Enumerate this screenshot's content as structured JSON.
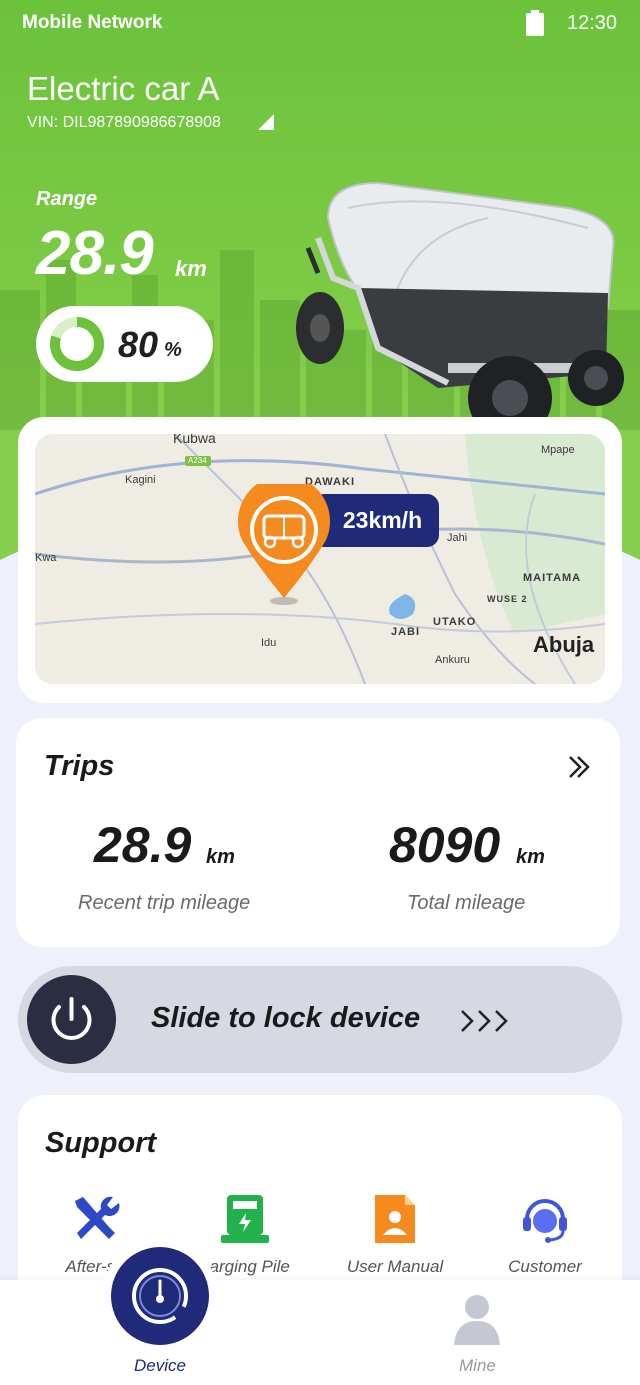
{
  "status_bar": {
    "network": "Mobile Network",
    "time": "12:30",
    "battery_icon": "battery-full-icon"
  },
  "vehicle": {
    "name": "Electric car A",
    "vin": "VIN: DIL987890986678908",
    "range_label": "Range",
    "range_value": "28.9",
    "range_unit": "km",
    "battery_percent": "80",
    "battery_percent_unit": "%",
    "battery_level": 0.8
  },
  "map": {
    "labels": [
      "Kubwa",
      "A234",
      "Kagini",
      "DAWAKI",
      "Mpape",
      "Jahi",
      "Kwa",
      "MAITAMA",
      "WUSE 2",
      "JABI",
      "UTAKO",
      "Idu",
      "Ankuru",
      "Abuja"
    ],
    "speed": "23km/h",
    "pin_icon": "tricycle-location-pin-icon"
  },
  "trips": {
    "title": "Trips",
    "more_icon": "double-chevron-right-icon",
    "recent_value": "28.9",
    "recent_unit": "km",
    "recent_label": "Recent trip mileage",
    "total_value": "8090",
    "total_unit": "km",
    "total_label": "Total mileage"
  },
  "lock_slider": {
    "label": "Slide to lock device",
    "knob_icon": "power-icon",
    "arrows": ">>>"
  },
  "support": {
    "title": "Support",
    "items": [
      {
        "label": "After-sa",
        "icon": "tools-icon"
      },
      {
        "label": "harging Pile",
        "icon": "charging-pile-icon"
      },
      {
        "label": "User Manual",
        "icon": "user-manual-icon"
      },
      {
        "label": "Customer",
        "icon": "customer-service-icon"
      }
    ]
  },
  "bottom_nav": {
    "device_label": "Device",
    "mine_label": "Mine"
  },
  "colors": {
    "brand_green": "#6cc23b",
    "navy": "#1f2b7a",
    "orange": "#f58a1f"
  }
}
